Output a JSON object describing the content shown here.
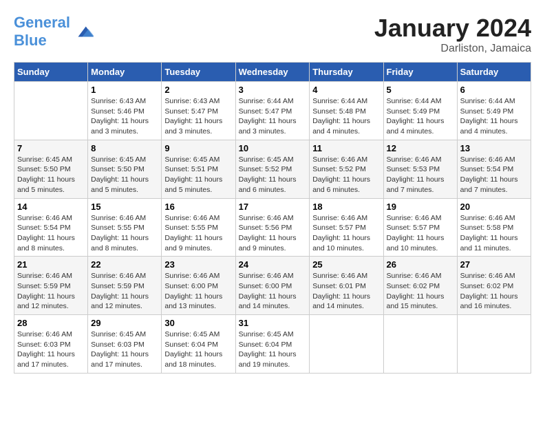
{
  "header": {
    "logo_general": "General",
    "logo_blue": "Blue",
    "month": "January 2024",
    "location": "Darliston, Jamaica"
  },
  "days_of_week": [
    "Sunday",
    "Monday",
    "Tuesday",
    "Wednesday",
    "Thursday",
    "Friday",
    "Saturday"
  ],
  "weeks": [
    [
      {
        "day": "",
        "info": ""
      },
      {
        "day": "1",
        "info": "Sunrise: 6:43 AM\nSunset: 5:46 PM\nDaylight: 11 hours\nand 3 minutes."
      },
      {
        "day": "2",
        "info": "Sunrise: 6:43 AM\nSunset: 5:47 PM\nDaylight: 11 hours\nand 3 minutes."
      },
      {
        "day": "3",
        "info": "Sunrise: 6:44 AM\nSunset: 5:47 PM\nDaylight: 11 hours\nand 3 minutes."
      },
      {
        "day": "4",
        "info": "Sunrise: 6:44 AM\nSunset: 5:48 PM\nDaylight: 11 hours\nand 4 minutes."
      },
      {
        "day": "5",
        "info": "Sunrise: 6:44 AM\nSunset: 5:49 PM\nDaylight: 11 hours\nand 4 minutes."
      },
      {
        "day": "6",
        "info": "Sunrise: 6:44 AM\nSunset: 5:49 PM\nDaylight: 11 hours\nand 4 minutes."
      }
    ],
    [
      {
        "day": "7",
        "info": "Sunrise: 6:45 AM\nSunset: 5:50 PM\nDaylight: 11 hours\nand 5 minutes."
      },
      {
        "day": "8",
        "info": "Sunrise: 6:45 AM\nSunset: 5:50 PM\nDaylight: 11 hours\nand 5 minutes."
      },
      {
        "day": "9",
        "info": "Sunrise: 6:45 AM\nSunset: 5:51 PM\nDaylight: 11 hours\nand 5 minutes."
      },
      {
        "day": "10",
        "info": "Sunrise: 6:45 AM\nSunset: 5:52 PM\nDaylight: 11 hours\nand 6 minutes."
      },
      {
        "day": "11",
        "info": "Sunrise: 6:46 AM\nSunset: 5:52 PM\nDaylight: 11 hours\nand 6 minutes."
      },
      {
        "day": "12",
        "info": "Sunrise: 6:46 AM\nSunset: 5:53 PM\nDaylight: 11 hours\nand 7 minutes."
      },
      {
        "day": "13",
        "info": "Sunrise: 6:46 AM\nSunset: 5:54 PM\nDaylight: 11 hours\nand 7 minutes."
      }
    ],
    [
      {
        "day": "14",
        "info": "Sunrise: 6:46 AM\nSunset: 5:54 PM\nDaylight: 11 hours\nand 8 minutes."
      },
      {
        "day": "15",
        "info": "Sunrise: 6:46 AM\nSunset: 5:55 PM\nDaylight: 11 hours\nand 8 minutes."
      },
      {
        "day": "16",
        "info": "Sunrise: 6:46 AM\nSunset: 5:55 PM\nDaylight: 11 hours\nand 9 minutes."
      },
      {
        "day": "17",
        "info": "Sunrise: 6:46 AM\nSunset: 5:56 PM\nDaylight: 11 hours\nand 9 minutes."
      },
      {
        "day": "18",
        "info": "Sunrise: 6:46 AM\nSunset: 5:57 PM\nDaylight: 11 hours\nand 10 minutes."
      },
      {
        "day": "19",
        "info": "Sunrise: 6:46 AM\nSunset: 5:57 PM\nDaylight: 11 hours\nand 10 minutes."
      },
      {
        "day": "20",
        "info": "Sunrise: 6:46 AM\nSunset: 5:58 PM\nDaylight: 11 hours\nand 11 minutes."
      }
    ],
    [
      {
        "day": "21",
        "info": "Sunrise: 6:46 AM\nSunset: 5:59 PM\nDaylight: 11 hours\nand 12 minutes."
      },
      {
        "day": "22",
        "info": "Sunrise: 6:46 AM\nSunset: 5:59 PM\nDaylight: 11 hours\nand 12 minutes."
      },
      {
        "day": "23",
        "info": "Sunrise: 6:46 AM\nSunset: 6:00 PM\nDaylight: 11 hours\nand 13 minutes."
      },
      {
        "day": "24",
        "info": "Sunrise: 6:46 AM\nSunset: 6:00 PM\nDaylight: 11 hours\nand 14 minutes."
      },
      {
        "day": "25",
        "info": "Sunrise: 6:46 AM\nSunset: 6:01 PM\nDaylight: 11 hours\nand 14 minutes."
      },
      {
        "day": "26",
        "info": "Sunrise: 6:46 AM\nSunset: 6:02 PM\nDaylight: 11 hours\nand 15 minutes."
      },
      {
        "day": "27",
        "info": "Sunrise: 6:46 AM\nSunset: 6:02 PM\nDaylight: 11 hours\nand 16 minutes."
      }
    ],
    [
      {
        "day": "28",
        "info": "Sunrise: 6:46 AM\nSunset: 6:03 PM\nDaylight: 11 hours\nand 17 minutes."
      },
      {
        "day": "29",
        "info": "Sunrise: 6:45 AM\nSunset: 6:03 PM\nDaylight: 11 hours\nand 17 minutes."
      },
      {
        "day": "30",
        "info": "Sunrise: 6:45 AM\nSunset: 6:04 PM\nDaylight: 11 hours\nand 18 minutes."
      },
      {
        "day": "31",
        "info": "Sunrise: 6:45 AM\nSunset: 6:04 PM\nDaylight: 11 hours\nand 19 minutes."
      },
      {
        "day": "",
        "info": ""
      },
      {
        "day": "",
        "info": ""
      },
      {
        "day": "",
        "info": ""
      }
    ]
  ]
}
